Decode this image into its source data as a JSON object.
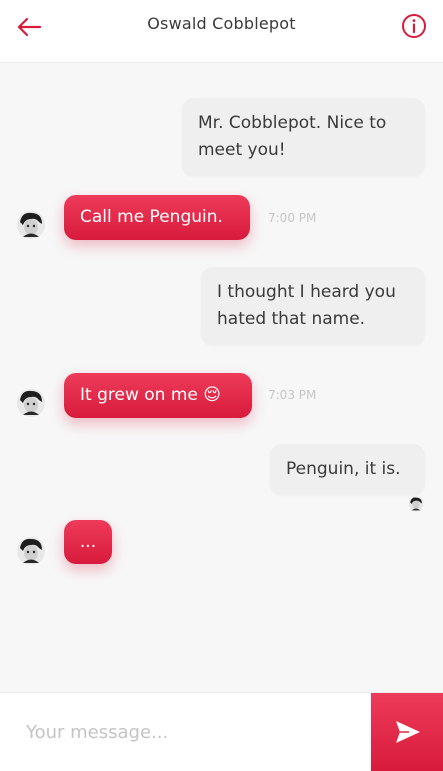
{
  "header": {
    "title": "Oswald Cobblepot",
    "back_icon": "arrow-left-icon",
    "info_icon": "info-icon",
    "accent_color": "#d81b3c"
  },
  "messages": [
    {
      "direction": "outgoing",
      "text": "Mr. Cobblepot. Nice to meet you!"
    },
    {
      "direction": "incoming",
      "text": "Call me Penguin.",
      "time": "7:00 PM"
    },
    {
      "direction": "outgoing",
      "text": "I thought I heard you hated that name."
    },
    {
      "direction": "incoming",
      "text": "It grew on me 😌",
      "time": "7:03 PM"
    },
    {
      "direction": "outgoing",
      "text": "Penguin, it is."
    },
    {
      "direction": "incoming",
      "text": "..."
    }
  ],
  "composer": {
    "placeholder": "Your message...",
    "send_icon": "send-icon"
  }
}
